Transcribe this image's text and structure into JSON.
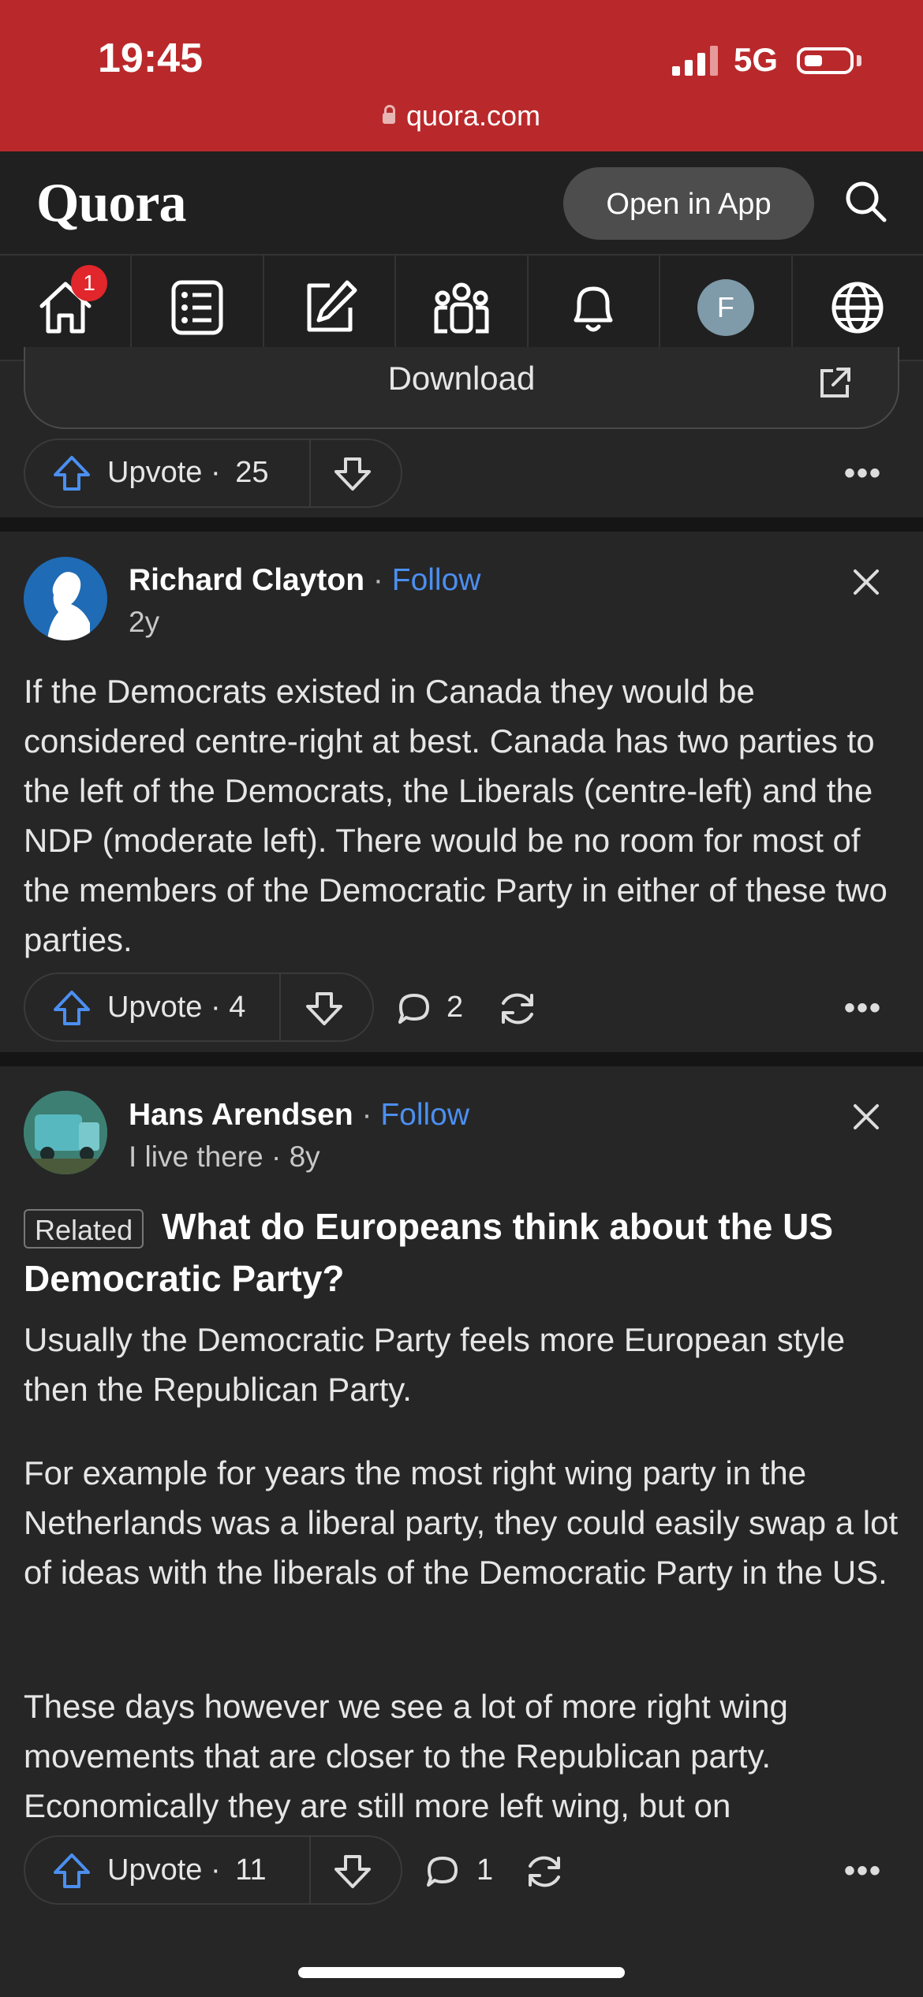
{
  "status_bar": {
    "time": "19:45",
    "network": "5G",
    "url": "quora.com"
  },
  "header": {
    "logo": "Quora",
    "open_in_app": "Open in App"
  },
  "nav": {
    "notification_badge": "1",
    "profile_initial": "F",
    "icons": [
      "home-icon",
      "answer-list-icon",
      "write-icon",
      "spaces-icon",
      "bell-icon",
      "profile-avatar",
      "globe-icon"
    ]
  },
  "top_post": {
    "download_label": "Download",
    "upvote_label": "Upvote",
    "upvote_sep": "·",
    "upvote_count": "25"
  },
  "post1": {
    "author": "Richard Clayton",
    "sep": "·",
    "follow": "Follow",
    "time": "2y",
    "body": "If the Democrats existed in Canada they would be considered centre-right at best. Canada has two parties to the left of the Democrats, the Liberals (centre-left) and the NDP (moderate left). There would be no room for most of the members of the Democratic Party in either of these two parties.",
    "upvote_label": "Upvote",
    "upvote_sep": "·",
    "upvote_count": "4",
    "comments": "2"
  },
  "post2": {
    "author": "Hans Arendsen",
    "sep": "·",
    "follow": "Follow",
    "credential": "I live there · 8y",
    "related_tag": "Related",
    "question": "What do Europeans think about the US Democratic Party?",
    "paragraphs": [
      "Usually the Democratic Party feels more European style then the Republican Party.",
      "For example for years the most right wing party in the Netherlands was a liberal party, they could easily swap a lot of ideas with the liberals of the Democratic Party in the US.",
      "These days however we see a lot of more right wing movements that are closer to the Republican party. Economically they are still more left wing, but on"
    ],
    "upvote_label": "Upvote",
    "upvote_sep": "·",
    "upvote_count": "11",
    "comments": "1"
  },
  "colors": {
    "status_bar": "#b9292b",
    "accent_blue": "#4b8ff0",
    "background": "#262626",
    "badge": "#e1262c"
  }
}
